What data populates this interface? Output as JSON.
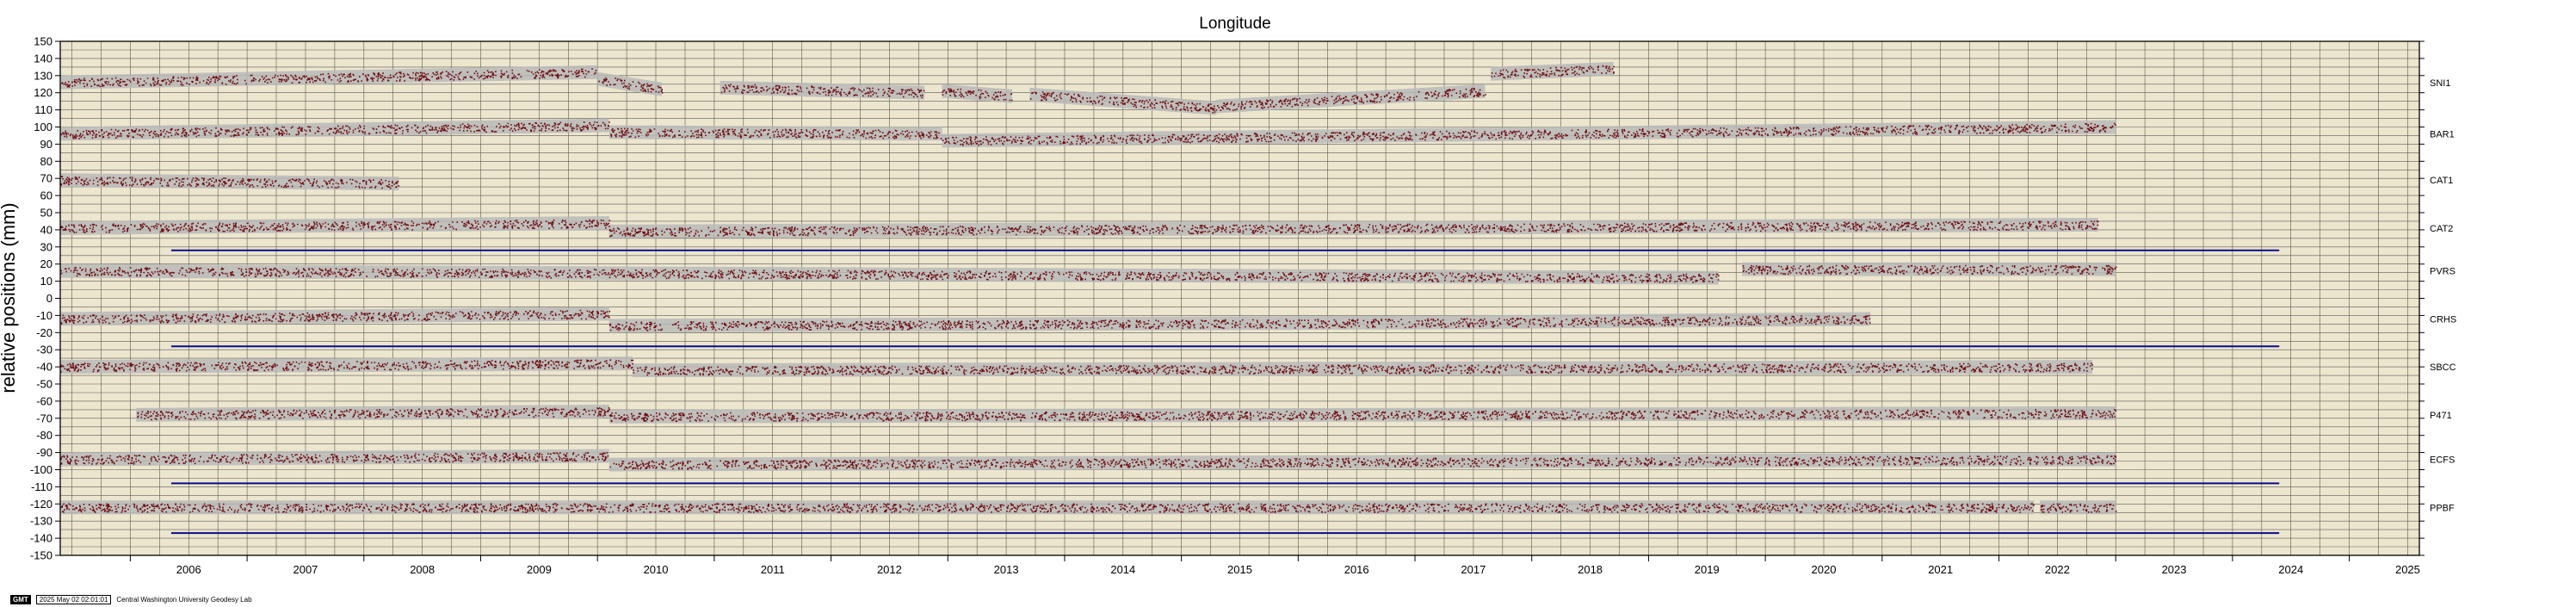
{
  "footer": {
    "logo": "GMT",
    "timestamp": "2025 May 02 02:01:01",
    "credit": "Central Washington University Geodesy Lab"
  },
  "colors": {
    "background": "#ece6cf",
    "grid": "#2b2b2b",
    "data_points": "#6e0d12",
    "error_band": "#b9b9b9",
    "reference_lines": "#0b0b8a"
  },
  "chart_data": {
    "type": "scatter",
    "title": "Longitude",
    "ylabel": "relative positions (mm)",
    "xlabel": "",
    "xlim": [
      2005.4,
      2025.6
    ],
    "ylim": [
      -150,
      150
    ],
    "grid": true,
    "x_ticks": [
      "2006",
      "2007",
      "2008",
      "2009",
      "2010",
      "2011",
      "2012",
      "2013",
      "2014",
      "2015",
      "2016",
      "2017",
      "2018",
      "2019",
      "2020",
      "2021",
      "2022",
      "2023",
      "2024",
      "2025"
    ],
    "y_ticks": [
      150,
      140,
      130,
      120,
      110,
      100,
      90,
      80,
      70,
      60,
      50,
      40,
      30,
      20,
      10,
      0,
      -10,
      -20,
      -30,
      -40,
      -50,
      -60,
      -70,
      -80,
      -90,
      -100,
      -110,
      -120,
      -130,
      -140,
      -150
    ],
    "series": [
      {
        "name": "SNI1",
        "segments": [
          {
            "x": [
              2005.4,
              2010.0
            ],
            "y": [
              126,
              132
            ]
          },
          {
            "x": [
              2010.0,
              2010.55
            ],
            "y": [
              128,
              122
            ]
          },
          {
            "x": [
              2011.05,
              2012.8
            ],
            "y": [
              123,
              120
            ]
          },
          {
            "x": [
              2012.95,
              2013.55
            ],
            "y": [
              121,
              118
            ]
          },
          {
            "x": [
              2013.7,
              2015.3
            ],
            "y": [
              119,
              111
            ]
          },
          {
            "x": [
              2015.3,
              2017.6
            ],
            "y": [
              112,
              121
            ]
          },
          {
            "x": [
              2017.65,
              2018.7
            ],
            "y": [
              131,
              134
            ]
          }
        ]
      },
      {
        "name": "BAR1",
        "segments": [
          {
            "x": [
              2005.4,
              2010.1
            ],
            "y": [
              96,
              101
            ]
          },
          {
            "x": [
              2010.1,
              2012.95
            ],
            "y": [
              97,
              96
            ]
          },
          {
            "x": [
              2012.95,
              2023.0
            ],
            "y": [
              92,
              100
            ]
          }
        ]
      },
      {
        "name": "CAT1",
        "segments": [
          {
            "x": [
              2005.4,
              2008.3
            ],
            "y": [
              69,
              67
            ]
          }
        ]
      },
      {
        "name": "CAT2",
        "segments": [
          {
            "x": [
              2005.4,
              2010.1
            ],
            "y": [
              41,
              44
            ]
          },
          {
            "x": [
              2010.1,
              2022.85
            ],
            "y": [
              39,
              43
            ]
          }
        ]
      },
      {
        "name": "PVRS",
        "segments": [
          {
            "x": [
              2005.4,
              2019.6
            ],
            "y": [
              16,
              12
            ]
          },
          {
            "x": [
              2019.8,
              2023.0
            ],
            "y": [
              17,
              17
            ]
          }
        ]
      },
      {
        "name": "CRHS",
        "segments": [
          {
            "x": [
              2005.4,
              2010.1
            ],
            "y": [
              -12,
              -9
            ]
          },
          {
            "x": [
              2010.1,
              2017.4
            ],
            "y": [
              -16,
              -14
            ]
          },
          {
            "x": [
              2017.4,
              2020.9
            ],
            "y": [
              -14,
              -12
            ]
          }
        ]
      },
      {
        "name": "SBCC",
        "segments": [
          {
            "x": [
              2005.4,
              2010.3
            ],
            "y": [
              -40,
              -38
            ]
          },
          {
            "x": [
              2010.3,
              2022.8
            ],
            "y": [
              -42,
              -40
            ]
          }
        ]
      },
      {
        "name": "P471",
        "segments": [
          {
            "x": [
              2006.05,
              2010.1
            ],
            "y": [
              -68,
              -66
            ]
          },
          {
            "x": [
              2010.1,
              2023.0
            ],
            "y": [
              -69,
              -67
            ]
          }
        ]
      },
      {
        "name": "ECFS",
        "segments": [
          {
            "x": [
              2005.4,
              2010.1
            ],
            "y": [
              -94,
              -92
            ]
          },
          {
            "x": [
              2010.1,
              2023.0
            ],
            "y": [
              -97,
              -94
            ]
          }
        ]
      },
      {
        "name": "PPBF",
        "segments": [
          {
            "x": [
              2005.4,
              2022.3
            ],
            "y": [
              -122,
              -122
            ]
          },
          {
            "x": [
              2022.35,
              2023.0
            ],
            "y": [
              -122,
              -122
            ]
          }
        ]
      }
    ],
    "reference_lines": [
      {
        "x": [
          2006.35,
          2024.4
        ],
        "y": 28
      },
      {
        "x": [
          2006.35,
          2024.4
        ],
        "y": -28
      },
      {
        "x": [
          2006.35,
          2024.4
        ],
        "y": -108
      },
      {
        "x": [
          2006.35,
          2024.4
        ],
        "y": -137
      }
    ]
  }
}
